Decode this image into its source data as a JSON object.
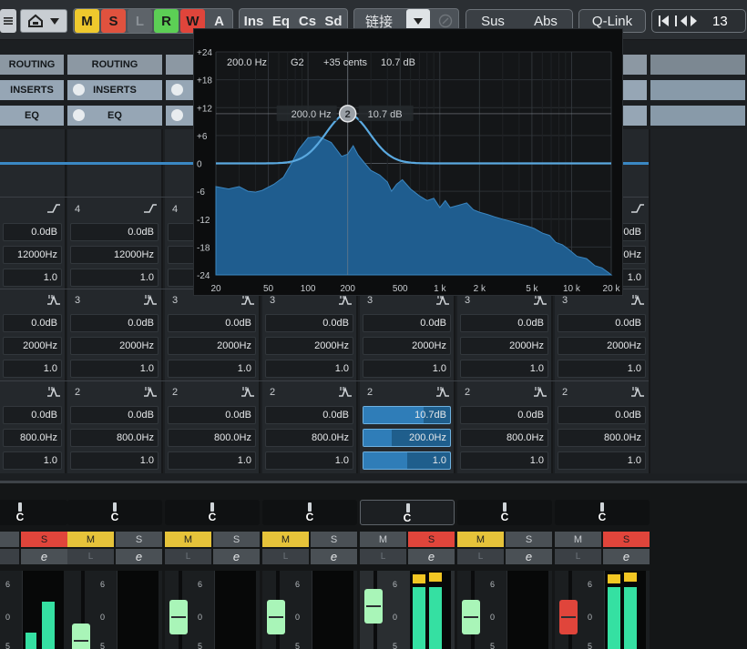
{
  "toolbar": {
    "automation": [
      "M",
      "S",
      "L",
      "R",
      "W",
      "A"
    ],
    "ins": "Ins",
    "eq": "Eq",
    "cs": "Cs",
    "sd": "Sd",
    "link": "链接",
    "sus": "Sus",
    "abs": "Abs",
    "qlink": "Q-Link",
    "channel_number": "13"
  },
  "headers": {
    "routing": [
      "ROUTING",
      "ROUTING"
    ],
    "inserts": [
      "INSERTS",
      "INSERTS"
    ],
    "eq": [
      "EQ",
      "EQ"
    ]
  },
  "band4": {
    "number": "4",
    "gain": "0.0dB",
    "freq": "12000Hz",
    "q": "1.0"
  },
  "band3": {
    "number": "3",
    "gain": "0.0dB",
    "freq": "2000Hz",
    "q": "1.0"
  },
  "band2": {
    "number": "2",
    "gain": "0.0dB",
    "freq": "800.0Hz",
    "q": "1.0",
    "active_gain": "10.7dB",
    "active_freq": "200.0Hz",
    "active_q": "1.0",
    "active_gain_fraction": 0.69,
    "active_freq_fraction": 0.33,
    "active_q_fraction": 0.5
  },
  "eq_popup": {
    "freq": "200.0 Hz",
    "note": "G2",
    "cents": "+35 cents",
    "gain": "10.7 dB",
    "node_freq": "200.0 Hz",
    "node_gain": "10.7 dB",
    "node_label": "2",
    "y_ticks": [
      "+24",
      "+18",
      "+12",
      "+6",
      "0",
      "-6",
      "-12",
      "-18",
      "-24"
    ],
    "x_ticks": [
      "20",
      "50",
      "100",
      "200",
      "500",
      "1 k",
      "2 k",
      "5 k",
      "10 k",
      "20 k"
    ]
  },
  "mixer": {
    "pan_label": "C",
    "mute": "M",
    "solo": "S",
    "listen": "L",
    "edit": "e",
    "scale_6": "6",
    "scale_0": "0",
    "scale_5": "5"
  }
}
